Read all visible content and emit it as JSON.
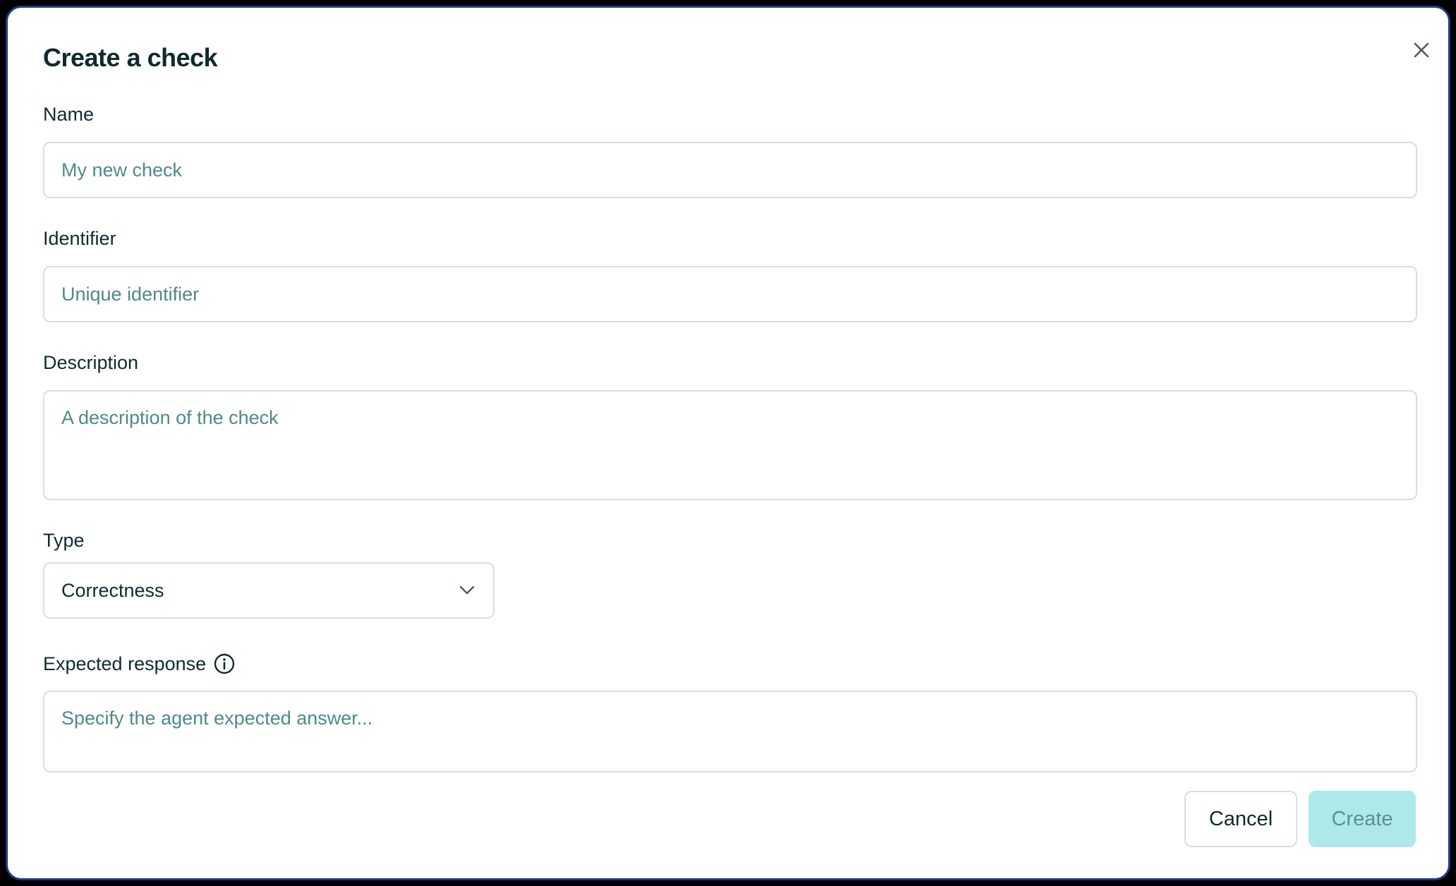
{
  "dialog": {
    "title": "Create a check",
    "close_icon": "close-icon"
  },
  "form": {
    "name": {
      "label": "Name",
      "placeholder": "My new check",
      "value": ""
    },
    "identifier": {
      "label": "Identifier",
      "placeholder": "Unique identifier",
      "value": ""
    },
    "description": {
      "label": "Description",
      "placeholder": "A description of the check",
      "value": ""
    },
    "type": {
      "label": "Type",
      "selected": "Correctness",
      "icon": "chevron-down-icon"
    },
    "expected_response": {
      "label": "Expected response",
      "placeholder": "Specify the agent expected answer...",
      "value": "",
      "icon": "info-icon"
    }
  },
  "actions": {
    "cancel_label": "Cancel",
    "create_label": "Create"
  },
  "colors": {
    "title_text": "#0f2a2e",
    "placeholder": "#4e8a87",
    "border": "#d9dee0",
    "create_bg": "#ade9e8",
    "create_text": "#5e8f93",
    "dialog_border": "#1f3a8a"
  }
}
